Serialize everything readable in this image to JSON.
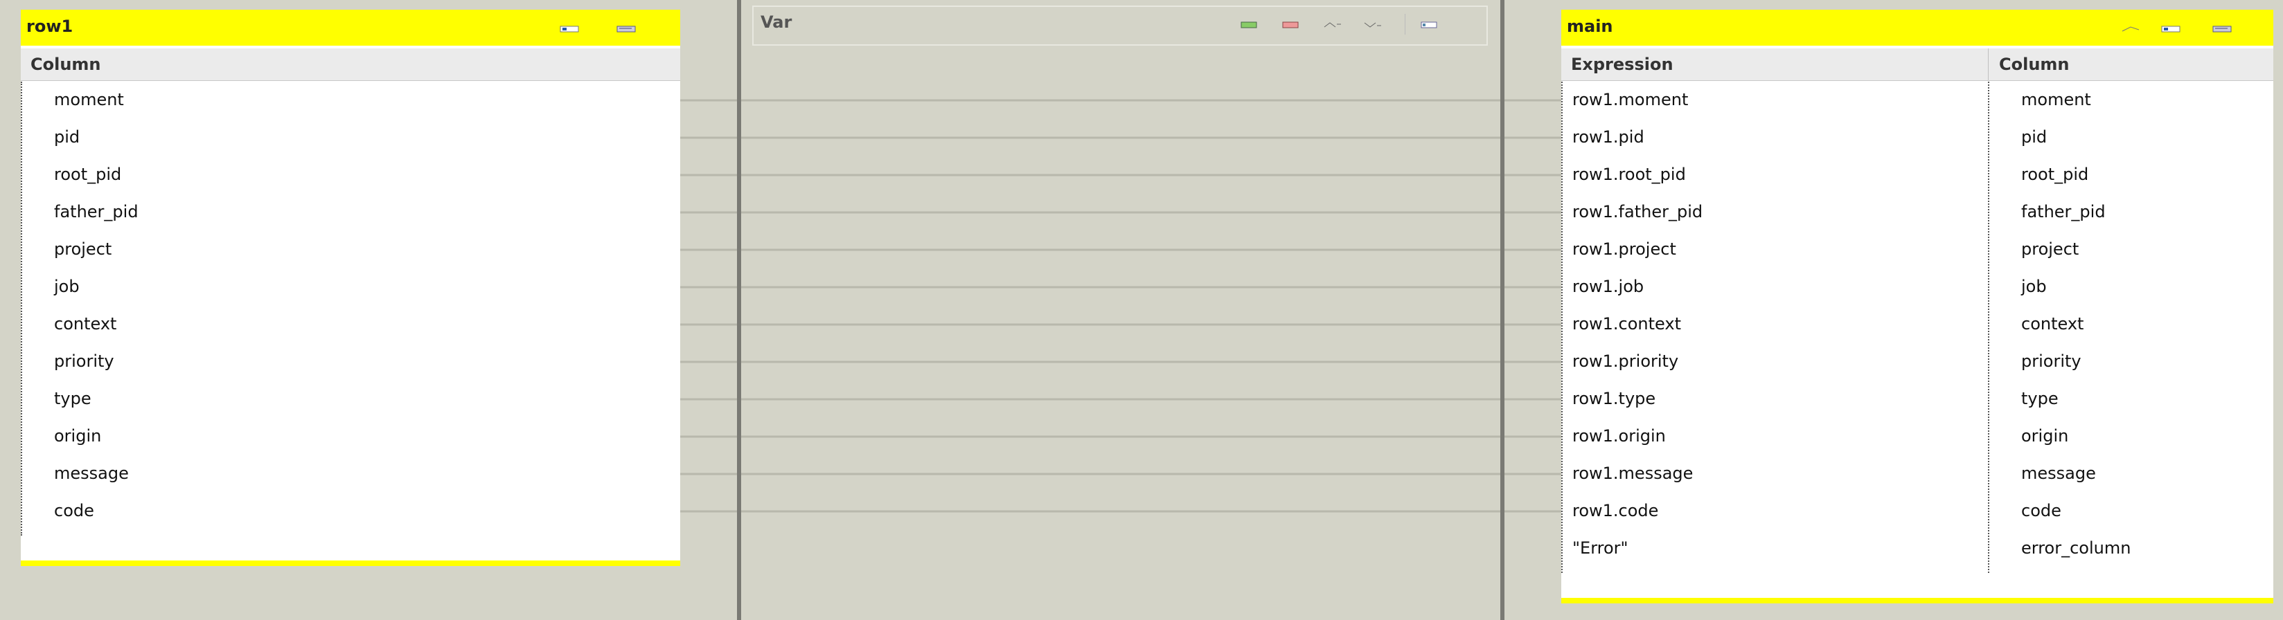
{
  "input_table": {
    "title": "row1",
    "column_header": "Column",
    "columns": [
      "moment",
      "pid",
      "root_pid",
      "father_pid",
      "project",
      "job",
      "context",
      "priority",
      "type",
      "origin",
      "message",
      "code"
    ],
    "toolbar_icons": [
      "auto-map-icon",
      "edit-schema-icon"
    ]
  },
  "var_panel": {
    "title": "Var",
    "toolbar_icons": [
      "add-variable-icon",
      "remove-variable-icon",
      "move-up-icon",
      "move-down-icon",
      "edit-schema-icon"
    ]
  },
  "output_table": {
    "title": "main",
    "expression_header": "Expression",
    "column_header": "Column",
    "rows": [
      {
        "expression": "row1.moment",
        "column": "moment"
      },
      {
        "expression": "row1.pid",
        "column": "pid"
      },
      {
        "expression": "row1.root_pid",
        "column": "root_pid"
      },
      {
        "expression": "row1.father_pid",
        "column": "father_pid"
      },
      {
        "expression": "row1.project",
        "column": "project"
      },
      {
        "expression": "row1.job",
        "column": "job"
      },
      {
        "expression": "row1.context",
        "column": "context"
      },
      {
        "expression": "row1.priority",
        "column": "priority"
      },
      {
        "expression": "row1.type",
        "column": "type"
      },
      {
        "expression": "row1.origin",
        "column": "origin"
      },
      {
        "expression": "row1.message",
        "column": "message"
      },
      {
        "expression": "row1.code",
        "column": "code"
      },
      {
        "expression": "\"Error\"",
        "column": "error_column"
      }
    ],
    "toolbar_icons": [
      "filter-icon",
      "auto-map-icon",
      "edit-schema-icon"
    ]
  }
}
